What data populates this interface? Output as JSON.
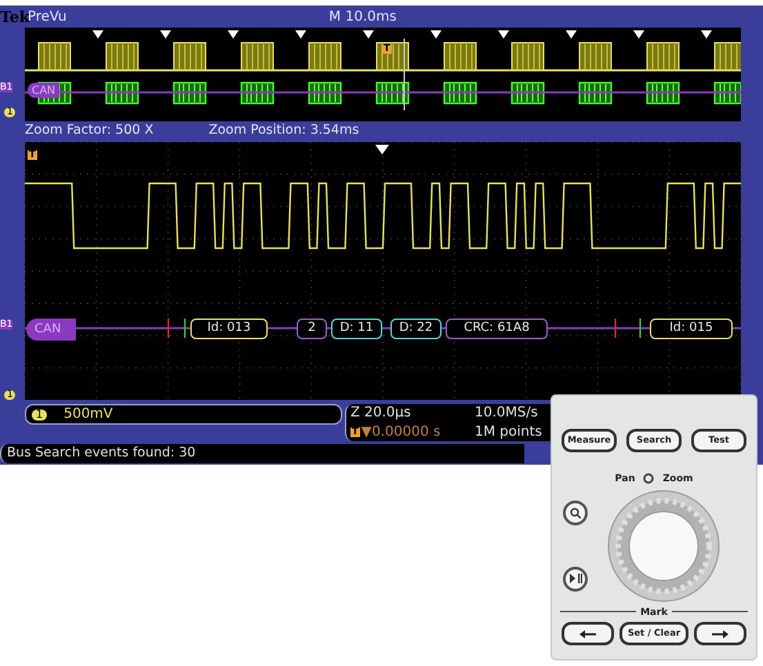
{
  "header": {
    "logo": "Tek",
    "mode": "PreVu",
    "timebase": "M 10.0ms"
  },
  "overview": {
    "bus_marker": "B1",
    "bus_label": "CAN",
    "channel_marker": "1",
    "trigger_marker": "T"
  },
  "zoom_info": {
    "factor": "Zoom Factor: 500 X",
    "position": "Zoom Position: 3.54ms"
  },
  "zoom_view": {
    "trigger_marker": "T",
    "bus_marker": "B1",
    "bus_label": "CAN",
    "channel_marker": "1",
    "packets": [
      {
        "kind": "id",
        "text": "Id: 013"
      },
      {
        "kind": "count",
        "text": "2"
      },
      {
        "kind": "data",
        "text": "D: 11"
      },
      {
        "kind": "data",
        "text": "D: 22"
      },
      {
        "kind": "crc",
        "text": "CRC: 61A8"
      },
      {
        "kind": "id",
        "text": "Id: 015"
      }
    ]
  },
  "status": {
    "channel": "1",
    "scale": "500mV",
    "zoom": "Z 20.0µs",
    "sample_rate": "10.0MS/s",
    "trigger_marker": "T",
    "trigger_offset": "▼0.00000 s",
    "record_length": "1M points"
  },
  "message": "Bus Search events found: 30",
  "panel": {
    "buttons": [
      "Measure",
      "Search",
      "Test"
    ],
    "knob_left": "Pan",
    "knob_right": "Zoom",
    "mark_label": "Mark",
    "mark_button": "Set / Clear"
  }
}
